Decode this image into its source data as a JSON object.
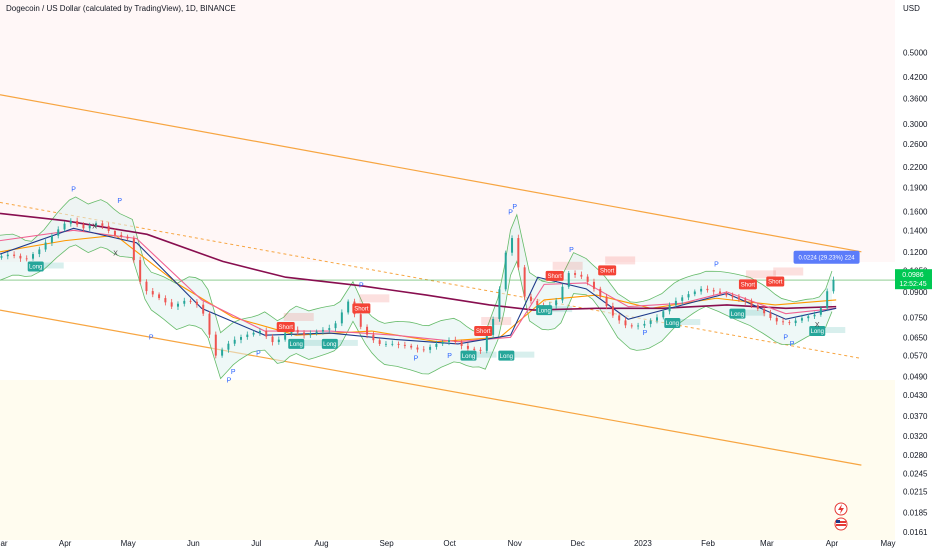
{
  "chart_data": {
    "type": "candlestick",
    "title": "Dogecoin / US Dollar (calculated by TradingView), 1D, BINANCE",
    "currency_label": "USD",
    "y_scale": "log",
    "ylim": [
      0.0152,
      0.66
    ],
    "xlim": [
      "2022-03-01",
      "2023-05-01"
    ],
    "y_ticks": [
      "0.5000",
      "0.4200",
      "0.3600",
      "0.3000",
      "0.2600",
      "0.2200",
      "0.1900",
      "0.1600",
      "0.1400",
      "0.1200",
      "0.1050",
      "0.0900",
      "0.0750",
      "0.0650",
      "0.0570",
      "0.0490",
      "0.0430",
      "0.0370",
      "0.0320",
      "0.0280",
      "0.0245",
      "0.0215",
      "0.0185",
      "0.0161"
    ],
    "x_ticks": [
      {
        "label": "ar",
        "date": "2022-03-01"
      },
      {
        "label": "Apr",
        "date": "2022-04-01"
      },
      {
        "label": "May",
        "date": "2022-05-01"
      },
      {
        "label": "Jun",
        "date": "2022-06-01"
      },
      {
        "label": "Jul",
        "date": "2022-07-01"
      },
      {
        "label": "Aug",
        "date": "2022-08-01"
      },
      {
        "label": "Sep",
        "date": "2022-09-01"
      },
      {
        "label": "Oct",
        "date": "2022-10-01"
      },
      {
        "label": "Nov",
        "date": "2022-11-01"
      },
      {
        "label": "Dec",
        "date": "2022-12-01"
      },
      {
        "label": "2023",
        "date": "2023-01-01"
      },
      {
        "label": "Feb",
        "date": "2023-02-01"
      },
      {
        "label": "Mar",
        "date": "2023-03-01"
      },
      {
        "label": "Apr",
        "date": "2023-04-01"
      },
      {
        "label": "May",
        "date": "2023-05-01"
      }
    ],
    "current_price": 0.0986,
    "current_price_label": "0.0986",
    "current_price_sub": "12:52:45",
    "measure_label": "0.0224 (29.23%) 224",
    "price_path": [
      [
        "2022-03-01",
        0.115
      ],
      [
        "2022-03-08",
        0.118
      ],
      [
        "2022-03-15",
        0.113
      ],
      [
        "2022-03-22",
        0.122
      ],
      [
        "2022-03-29",
        0.137
      ],
      [
        "2022-04-05",
        0.151
      ],
      [
        "2022-04-12",
        0.142
      ],
      [
        "2022-04-19",
        0.148
      ],
      [
        "2022-04-26",
        0.136
      ],
      [
        "2022-05-03",
        0.132
      ],
      [
        "2022-05-10",
        0.092
      ],
      [
        "2022-05-17",
        0.087
      ],
      [
        "2022-05-24",
        0.081
      ],
      [
        "2022-05-31",
        0.085
      ],
      [
        "2022-06-07",
        0.081
      ],
      [
        "2022-06-14",
        0.057
      ],
      [
        "2022-06-21",
        0.063
      ],
      [
        "2022-06-28",
        0.066
      ],
      [
        "2022-07-05",
        0.068
      ],
      [
        "2022-07-12",
        0.062
      ],
      [
        "2022-07-19",
        0.069
      ],
      [
        "2022-07-26",
        0.066
      ],
      [
        "2022-08-02",
        0.068
      ],
      [
        "2022-08-09",
        0.07
      ],
      [
        "2022-08-16",
        0.084
      ],
      [
        "2022-08-23",
        0.068
      ],
      [
        "2022-08-30",
        0.062
      ],
      [
        "2022-09-06",
        0.062
      ],
      [
        "2022-09-13",
        0.061
      ],
      [
        "2022-09-20",
        0.059
      ],
      [
        "2022-09-27",
        0.062
      ],
      [
        "2022-10-04",
        0.064
      ],
      [
        "2022-10-11",
        0.06
      ],
      [
        "2022-10-18",
        0.059
      ],
      [
        "2022-10-25",
        0.077
      ],
      [
        "2022-11-01",
        0.142
      ],
      [
        "2022-11-08",
        0.087
      ],
      [
        "2022-11-15",
        0.081
      ],
      [
        "2022-11-22",
        0.082
      ],
      [
        "2022-11-29",
        0.103
      ],
      [
        "2022-12-06",
        0.1
      ],
      [
        "2022-12-13",
        0.089
      ],
      [
        "2022-12-20",
        0.076
      ],
      [
        "2022-12-27",
        0.07
      ],
      [
        "2023-01-03",
        0.071
      ],
      [
        "2023-01-10",
        0.075
      ],
      [
        "2023-01-17",
        0.083
      ],
      [
        "2023-01-24",
        0.088
      ],
      [
        "2023-01-31",
        0.092
      ],
      [
        "2023-02-07",
        0.09
      ],
      [
        "2023-02-14",
        0.087
      ],
      [
        "2023-02-21",
        0.084
      ],
      [
        "2023-02-28",
        0.079
      ],
      [
        "2023-03-07",
        0.073
      ],
      [
        "2023-03-14",
        0.072
      ],
      [
        "2023-03-21",
        0.075
      ],
      [
        "2023-03-28",
        0.077
      ],
      [
        "2023-04-03",
        0.098
      ]
    ],
    "series": [
      {
        "name": "",
        "color": "#ff9800",
        "kind": "ma",
        "values": [
          [
            "2022-03-01",
            0.12
          ],
          [
            "2022-04-01",
            0.13
          ],
          [
            "2022-04-25",
            0.135
          ],
          [
            "2022-05-25",
            0.095
          ],
          [
            "2022-06-20",
            0.075
          ],
          [
            "2022-07-20",
            0.066
          ],
          [
            "2022-08-25",
            0.068
          ],
          [
            "2022-09-25",
            0.063
          ],
          [
            "2022-10-25",
            0.065
          ],
          [
            "2022-11-15",
            0.085
          ],
          [
            "2022-12-10",
            0.088
          ],
          [
            "2023-01-05",
            0.08
          ],
          [
            "2023-02-05",
            0.086
          ],
          [
            "2023-03-05",
            0.082
          ],
          [
            "2023-04-03",
            0.085
          ]
        ]
      },
      {
        "name": "",
        "color": "#880e4f",
        "kind": "ma",
        "values": [
          [
            "2022-03-01",
            0.158
          ],
          [
            "2022-04-01",
            0.15
          ],
          [
            "2022-05-10",
            0.136
          ],
          [
            "2022-06-15",
            0.112
          ],
          [
            "2022-07-15",
            0.1
          ],
          [
            "2022-08-20",
            0.094
          ],
          [
            "2022-09-20",
            0.088
          ],
          [
            "2022-10-20",
            0.082
          ],
          [
            "2022-11-10",
            0.079
          ],
          [
            "2022-12-10",
            0.08
          ],
          [
            "2023-01-10",
            0.08
          ],
          [
            "2023-02-10",
            0.082
          ],
          [
            "2023-03-10",
            0.08
          ],
          [
            "2023-04-03",
            0.081
          ]
        ]
      },
      {
        "name": "",
        "color": "#f06292",
        "kind": "ma",
        "values": [
          [
            "2022-03-01",
            0.13
          ],
          [
            "2022-04-05",
            0.14
          ],
          [
            "2022-05-05",
            0.132
          ],
          [
            "2022-06-05",
            0.085
          ],
          [
            "2022-07-05",
            0.068
          ],
          [
            "2022-08-05",
            0.068
          ],
          [
            "2022-09-05",
            0.066
          ],
          [
            "2022-10-05",
            0.063
          ],
          [
            "2022-10-30",
            0.065
          ],
          [
            "2022-11-15",
            0.095
          ],
          [
            "2022-12-05",
            0.096
          ],
          [
            "2022-12-25",
            0.081
          ],
          [
            "2023-01-20",
            0.083
          ],
          [
            "2023-02-10",
            0.09
          ],
          [
            "2023-03-10",
            0.077
          ],
          [
            "2023-04-03",
            0.08
          ]
        ]
      },
      {
        "name": "",
        "color": "#1e3a8a",
        "kind": "ma",
        "values": [
          [
            "2022-03-01",
            0.118
          ],
          [
            "2022-04-05",
            0.142
          ],
          [
            "2022-05-05",
            0.128
          ],
          [
            "2022-06-05",
            0.08
          ],
          [
            "2022-07-05",
            0.066
          ],
          [
            "2022-08-05",
            0.067
          ],
          [
            "2022-09-05",
            0.064
          ],
          [
            "2022-10-05",
            0.062
          ],
          [
            "2022-10-30",
            0.066
          ],
          [
            "2022-11-12",
            0.1
          ],
          [
            "2022-12-05",
            0.092
          ],
          [
            "2022-12-25",
            0.074
          ],
          [
            "2023-01-20",
            0.082
          ],
          [
            "2023-02-10",
            0.089
          ],
          [
            "2023-03-10",
            0.074
          ],
          [
            "2023-04-03",
            0.08
          ]
        ]
      }
    ],
    "channel": {
      "color": "#f7a541",
      "upper": [
        [
          "2022-03-01",
          0.37
        ],
        [
          "2023-04-15",
          0.12
        ]
      ],
      "lower": [
        [
          "2022-03-01",
          0.079
        ],
        [
          "2023-04-15",
          0.026
        ]
      ]
    },
    "horizontal_line": {
      "price": 0.098,
      "color": "#4caf50"
    },
    "markers": [
      {
        "type": "short",
        "text": "Short",
        "date": "2022-08-20",
        "price": 0.08
      },
      {
        "type": "short",
        "text": "Short",
        "date": "2022-07-15",
        "price": 0.07
      },
      {
        "type": "short",
        "text": "Short",
        "date": "2022-10-17",
        "price": 0.068
      },
      {
        "type": "short",
        "text": "Short",
        "date": "2022-11-20",
        "price": 0.101
      },
      {
        "type": "short",
        "text": "Short",
        "date": "2022-12-15",
        "price": 0.105
      },
      {
        "type": "short",
        "text": "Short",
        "date": "2023-02-20",
        "price": 0.095
      },
      {
        "type": "short",
        "text": "Short",
        "date": "2023-03-05",
        "price": 0.097
      },
      {
        "type": "long",
        "text": "Long",
        "date": "2022-03-18",
        "price": 0.108
      },
      {
        "type": "long",
        "text": "Long",
        "date": "2022-07-20",
        "price": 0.062
      },
      {
        "type": "long",
        "text": "Long",
        "date": "2022-08-05",
        "price": 0.062
      },
      {
        "type": "long",
        "text": "Long",
        "date": "2022-10-10",
        "price": 0.057
      },
      {
        "type": "long",
        "text": "Long",
        "date": "2022-10-28",
        "price": 0.057
      },
      {
        "type": "long",
        "text": "Long",
        "date": "2023-02-15",
        "price": 0.077
      },
      {
        "type": "long",
        "text": "Long",
        "date": "2023-03-25",
        "price": 0.068
      },
      {
        "type": "long",
        "text": "Long",
        "date": "2022-11-15",
        "price": 0.079
      },
      {
        "type": "long",
        "text": "Long",
        "date": "2023-01-15",
        "price": 0.072
      }
    ],
    "pivots": [
      {
        "text": "P",
        "date": "2022-04-05",
        "price": 0.185
      },
      {
        "text": "P",
        "date": "2022-04-27",
        "price": 0.17
      },
      {
        "text": "P",
        "date": "2022-05-12",
        "price": 0.064
      },
      {
        "text": "P",
        "date": "2022-06-18",
        "price": 0.047
      },
      {
        "text": "P",
        "date": "2022-06-20",
        "price": 0.05
      },
      {
        "text": "P",
        "date": "2022-07-02",
        "price": 0.057
      },
      {
        "text": "P",
        "date": "2022-08-20",
        "price": 0.093
      },
      {
        "text": "P",
        "date": "2022-09-15",
        "price": 0.055
      },
      {
        "text": "P",
        "date": "2022-10-01",
        "price": 0.056
      },
      {
        "text": "P",
        "date": "2022-11-01",
        "price": 0.163
      },
      {
        "text": "P",
        "date": "2022-10-30",
        "price": 0.157
      },
      {
        "text": "P",
        "date": "2022-11-28",
        "price": 0.12
      },
      {
        "text": "P",
        "date": "2023-01-02",
        "price": 0.066
      },
      {
        "text": "P",
        "date": "2023-02-05",
        "price": 0.108
      },
      {
        "text": "P",
        "date": "2023-03-10",
        "price": 0.064
      },
      {
        "text": "P",
        "date": "2023-03-13",
        "price": 0.061
      },
      {
        "text": "P",
        "date": "2023-04-03",
        "price": 0.115
      }
    ],
    "x_marks": [
      {
        "text": "X",
        "date": "2022-04-15",
        "price": 0.142
      },
      {
        "text": "X",
        "date": "2022-04-25",
        "price": 0.117
      },
      {
        "text": "X",
        "date": "2023-03-25",
        "price": 0.07
      }
    ]
  },
  "icons": {
    "lightning": "lightning-icon",
    "flag": "flag-icon"
  }
}
